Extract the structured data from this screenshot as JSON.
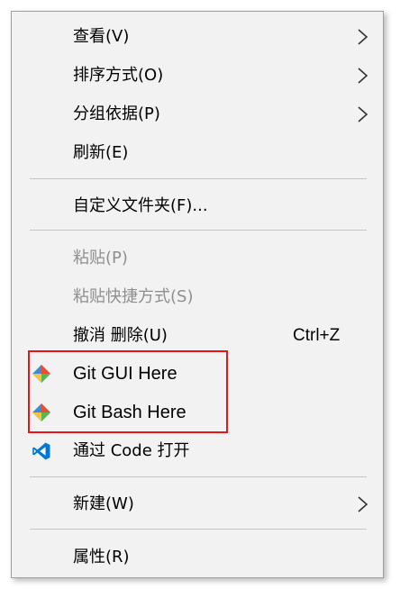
{
  "menu": {
    "view": {
      "label": "查看(V)"
    },
    "sort": {
      "label": "排序方式(O)"
    },
    "group": {
      "label": "分组依据(P)"
    },
    "refresh": {
      "label": "刷新(E)"
    },
    "customize": {
      "label": "自定义文件夹(F)..."
    },
    "paste": {
      "label": "粘贴(P)"
    },
    "paste_shortcut": {
      "label": "粘贴快捷方式(S)"
    },
    "undo_delete": {
      "label": "撤消 删除(U)",
      "shortcut": "Ctrl+Z"
    },
    "git_gui": {
      "label": "Git GUI Here",
      "icon": "git-icon"
    },
    "git_bash": {
      "label": "Git Bash Here",
      "icon": "git-icon"
    },
    "open_code": {
      "label": "通过 Code 打开",
      "icon": "vscode-icon"
    },
    "new": {
      "label": "新建(W)"
    },
    "properties": {
      "label": "属性(R)"
    }
  },
  "colors": {
    "menu_background": "#f2f2f2",
    "highlight_border": "#e8141a",
    "git_red": "#e94e31",
    "git_green": "#5ab552",
    "git_blue": "#3e8dd2",
    "git_yellow": "#f6c343",
    "vscode_blue": "#0078d4",
    "disabled_text": "#8f8f8f"
  }
}
